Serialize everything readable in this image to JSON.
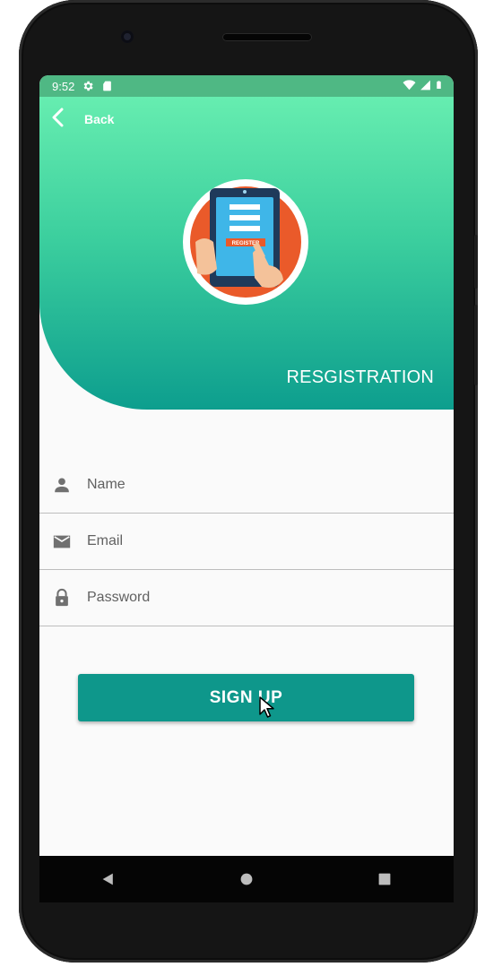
{
  "status_bar": {
    "time": "9:52",
    "icons_left": [
      "settings-icon",
      "sd-card-icon"
    ],
    "icons_right": [
      "wifi-icon",
      "signal-icon",
      "battery-icon"
    ]
  },
  "header": {
    "back_label": "Back",
    "title": "RESGISTRATION",
    "logo_text": "REGISTER",
    "gradient": [
      "#66edb0",
      "#0d9e8e"
    ]
  },
  "form": {
    "name_placeholder": "Name",
    "email_placeholder": "Email",
    "password_placeholder": "Password",
    "signup_label": "SIGN UP"
  },
  "colors": {
    "accent": "#0e978b",
    "status_bar": "#4fb884",
    "background": "#fafafa"
  },
  "nav": {
    "buttons": [
      "back-triangle-icon",
      "home-circle-icon",
      "recents-square-icon"
    ]
  }
}
